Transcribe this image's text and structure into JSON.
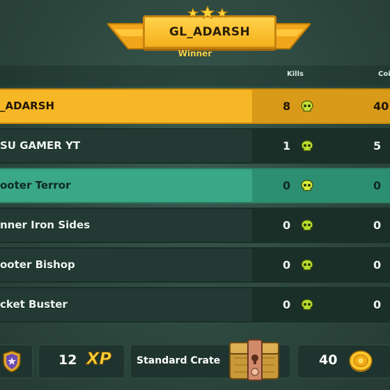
{
  "header": {
    "player_name": "GL_ADARSH",
    "subtitle": "Winner",
    "star_count": 3
  },
  "table": {
    "columns": {
      "kills": "Kills",
      "coins": "Coi"
    },
    "rows": [
      {
        "name": "_ADARSH",
        "kills": "8",
        "coins": "40",
        "style": "gold"
      },
      {
        "name": "SU GAMER YT",
        "kills": "1",
        "coins": "5",
        "style": "dark"
      },
      {
        "name": "ooter Terror",
        "kills": "0",
        "coins": "0",
        "style": "teal"
      },
      {
        "name": "nner Iron Sides",
        "kills": "0",
        "coins": "0",
        "style": "dark"
      },
      {
        "name": "ooter Bishop",
        "kills": "0",
        "coins": "0",
        "style": "dark"
      },
      {
        "name": "cket Buster",
        "kills": "0",
        "coins": "0",
        "style": "dark"
      }
    ]
  },
  "rewards": {
    "xp_value": "12",
    "xp_label": "XP",
    "crate_label": "Standard Crate",
    "coins_value": "40"
  },
  "colors": {
    "background": "#2f4a41",
    "gold_row": "#f6b726",
    "teal_row": "#3aa786",
    "dark_row": "#223a33",
    "skull": "#b7dc2e",
    "banner": "#f4b01a"
  },
  "icons": [
    "star-icon",
    "skull-icon",
    "shield-badge-icon",
    "crate-icon",
    "coin-icon"
  ]
}
